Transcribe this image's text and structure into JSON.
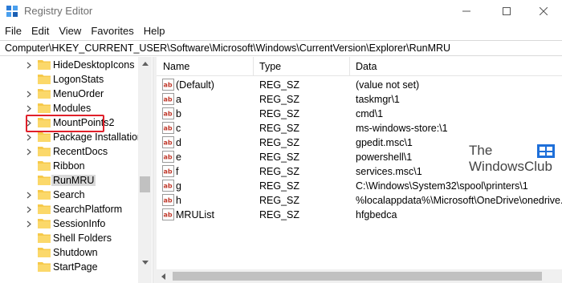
{
  "window": {
    "title": "Registry Editor",
    "controls": [
      "minimize-icon",
      "maximize-icon",
      "close-icon"
    ]
  },
  "menu": [
    "File",
    "Edit",
    "View",
    "Favorites",
    "Help"
  ],
  "address": "Computer\\HKEY_CURRENT_USER\\Software\\Microsoft\\Windows\\CurrentVersion\\Explorer\\RunMRU",
  "tree": {
    "items": [
      {
        "label": "HideDesktopIcons",
        "expandable": true
      },
      {
        "label": "LogonStats",
        "expandable": false
      },
      {
        "label": "MenuOrder",
        "expandable": true
      },
      {
        "label": "Modules",
        "expandable": true
      },
      {
        "label": "MountPoints2",
        "expandable": true
      },
      {
        "label": "Package Installation",
        "expandable": true
      },
      {
        "label": "RecentDocs",
        "expandable": true
      },
      {
        "label": "Ribbon",
        "expandable": false
      },
      {
        "label": "RunMRU",
        "expandable": false,
        "selected": true
      },
      {
        "label": "Search",
        "expandable": true
      },
      {
        "label": "SearchPlatform",
        "expandable": true
      },
      {
        "label": "SessionInfo",
        "expandable": true
      },
      {
        "label": "Shell Folders",
        "expandable": false
      },
      {
        "label": "Shutdown",
        "expandable": false
      },
      {
        "label": "StartPage",
        "expandable": false
      }
    ],
    "highlight_color": "#e0202a"
  },
  "list": {
    "columns": [
      "Name",
      "Type",
      "Data"
    ],
    "rows": [
      {
        "name": "(Default)",
        "type": "REG_SZ",
        "data": "(value not set)"
      },
      {
        "name": "a",
        "type": "REG_SZ",
        "data": "taskmgr\\1"
      },
      {
        "name": "b",
        "type": "REG_SZ",
        "data": "cmd\\1"
      },
      {
        "name": "c",
        "type": "REG_SZ",
        "data": "ms-windows-store:\\1"
      },
      {
        "name": "d",
        "type": "REG_SZ",
        "data": "gpedit.msc\\1"
      },
      {
        "name": "e",
        "type": "REG_SZ",
        "data": "powershell\\1"
      },
      {
        "name": "f",
        "type": "REG_SZ",
        "data": "services.msc\\1"
      },
      {
        "name": "g",
        "type": "REG_SZ",
        "data": "C:\\Windows\\System32\\spool\\printers\\1"
      },
      {
        "name": "h",
        "type": "REG_SZ",
        "data": "%localappdata%\\Microsoft\\OneDrive\\onedrive.e"
      },
      {
        "name": "MRUList",
        "type": "REG_SZ",
        "data": "hfgbedca"
      }
    ]
  },
  "watermark": {
    "line1": "The",
    "line2": "WindowsClub"
  },
  "colors": {
    "folder": "#f6c94a",
    "accent": "#1e6fd9"
  }
}
